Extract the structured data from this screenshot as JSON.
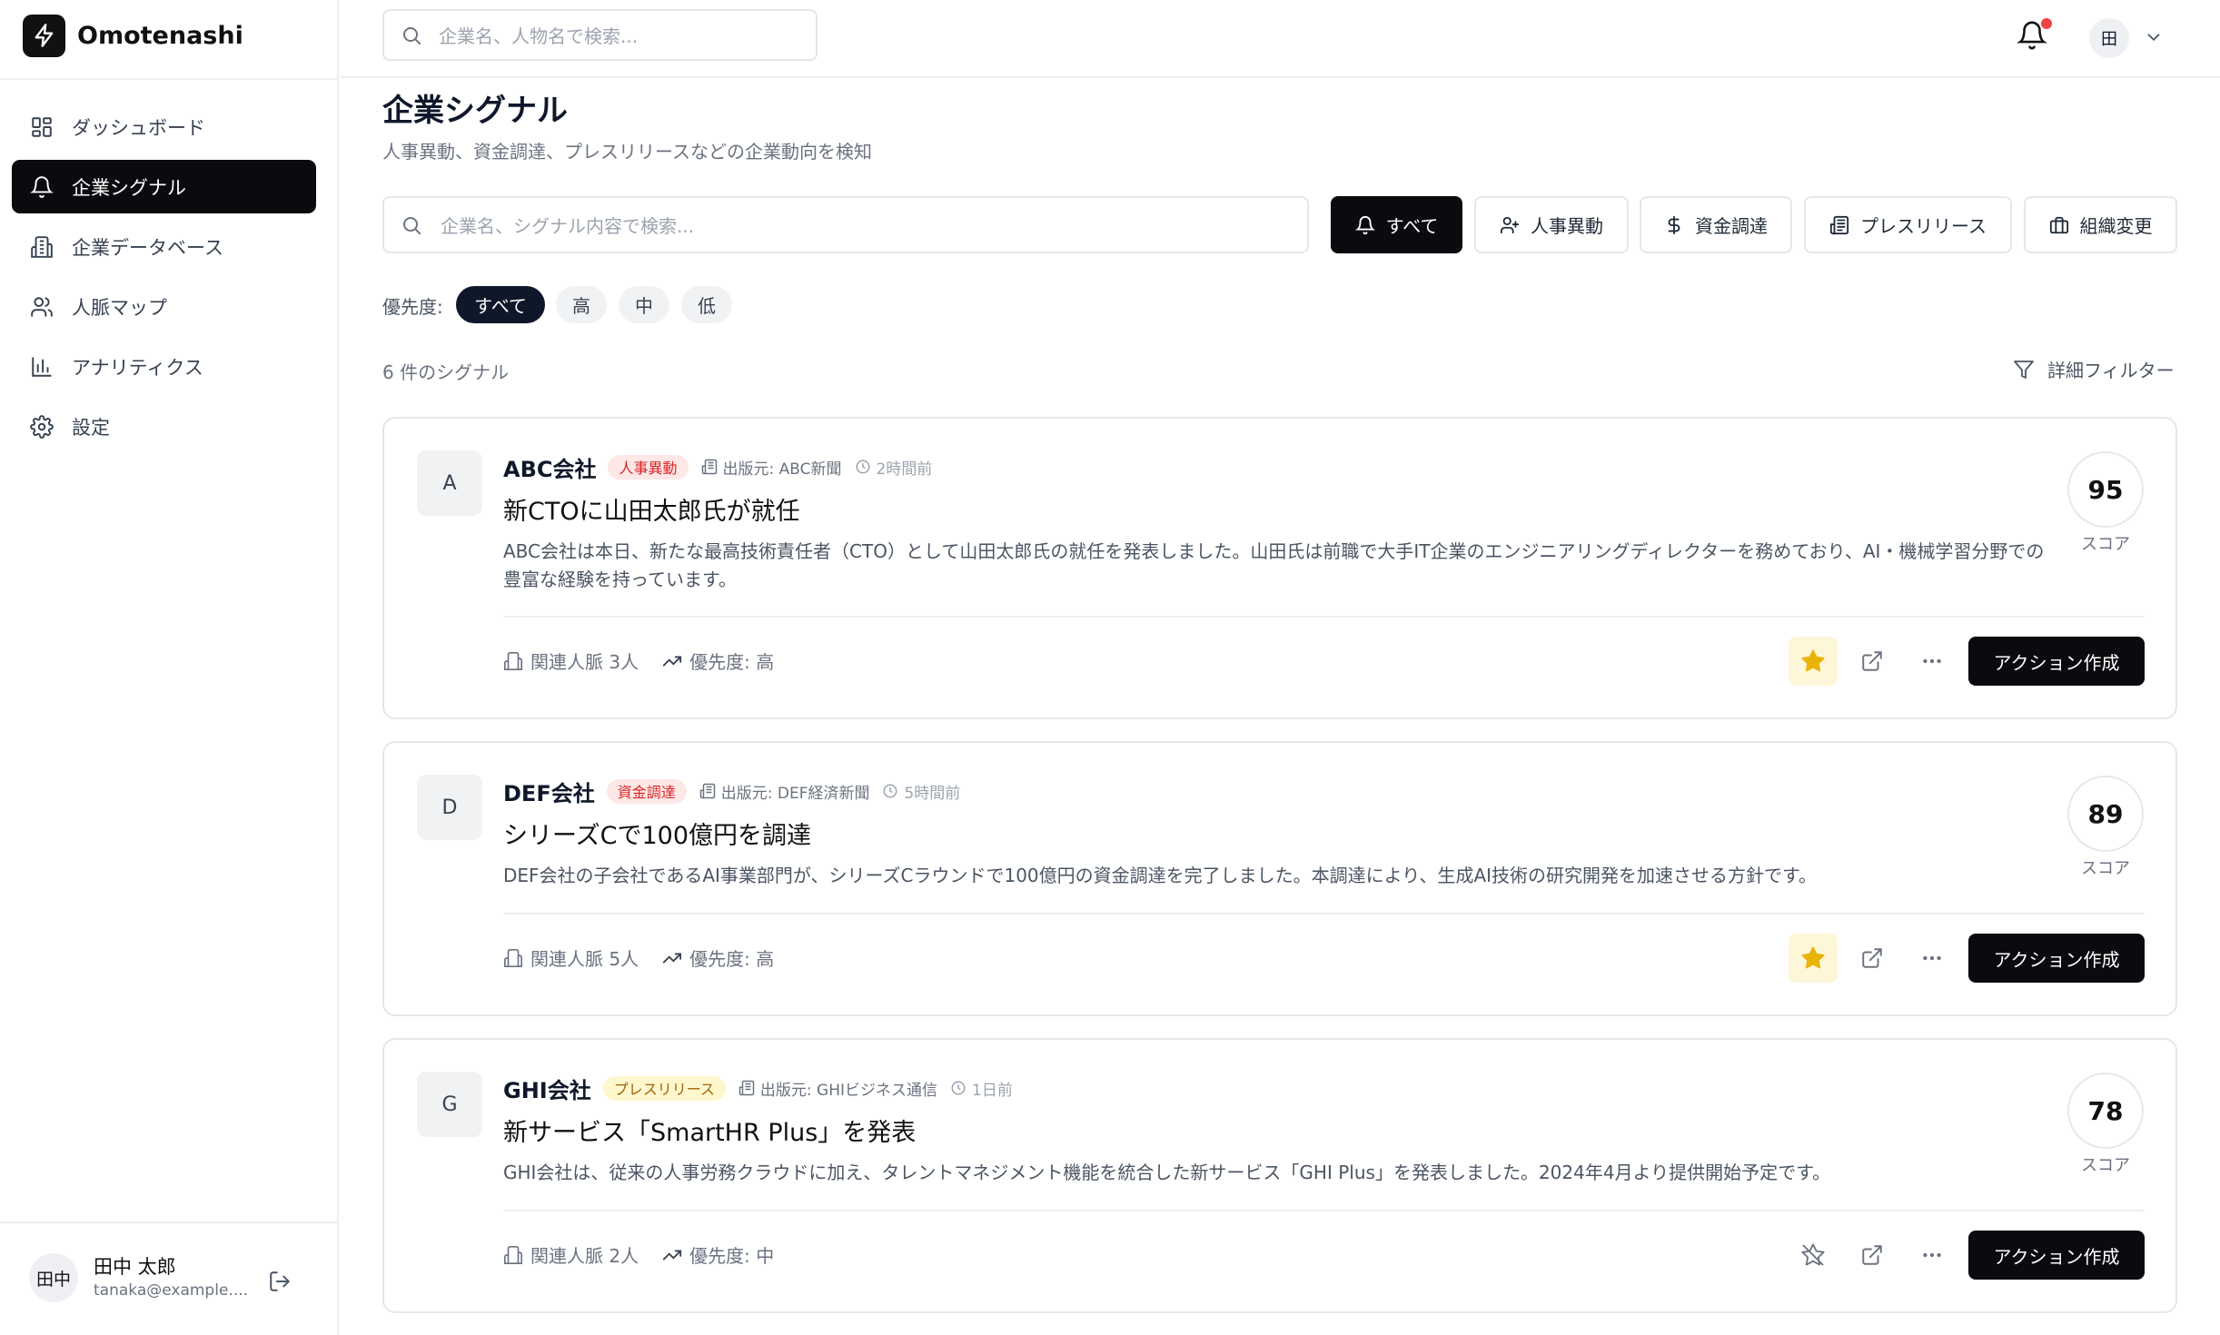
{
  "app": {
    "name": "Omotenashi"
  },
  "sidebar": {
    "items": [
      {
        "label": "ダッシュボード",
        "icon": "dashboard-icon"
      },
      {
        "label": "企業シグナル",
        "icon": "bell-icon",
        "active": true
      },
      {
        "label": "企業データベース",
        "icon": "building-icon"
      },
      {
        "label": "人脈マップ",
        "icon": "users-icon"
      },
      {
        "label": "アナリティクス",
        "icon": "bar-chart-icon"
      },
      {
        "label": "設定",
        "icon": "gear-icon"
      }
    ],
    "user": {
      "initials": "田中",
      "name": "田中 太郎",
      "email": "tanaka@example...."
    }
  },
  "topbar": {
    "search_placeholder": "企業名、人物名で検索...",
    "avatar_initial": "田"
  },
  "page": {
    "title": "企業シグナル",
    "subtitle": "人事異動、資金調達、プレスリリースなどの企業動向を検知"
  },
  "filters": {
    "search_placeholder": "企業名、シグナル内容で検索...",
    "types": [
      "すべて",
      "人事異動",
      "資金調達",
      "プレスリリース",
      "組織変更"
    ],
    "active_type": "すべて",
    "priority_label": "優先度:",
    "priorities": [
      "すべて",
      "高",
      "中",
      "低"
    ],
    "active_priority": "すべて",
    "count_text": "6 件のシグナル",
    "advanced_label": "詳細フィルター"
  },
  "signals": [
    {
      "initial": "A",
      "company": "ABC会社",
      "tag": "人事異動",
      "tag_color": "red",
      "source": "出版元: ABC新聞",
      "time": "2時間前",
      "title": "新CTOに山田太郎氏が就任",
      "description": "ABC会社は本日、新たな最高技術責任者（CTO）として山田太郎氏の就任を発表しました。山田氏は前職で大手IT企業のエンジニアリングディレクターを務めており、AI・機械学習分野での豊富な経験を持っています。",
      "related": "関連人脈 3人",
      "priority": "優先度: 高",
      "score": "95",
      "score_label": "スコア",
      "starred": true,
      "action_label": "アクション作成"
    },
    {
      "initial": "D",
      "company": "DEF会社",
      "tag": "資金調達",
      "tag_color": "red",
      "source": "出版元: DEF経済新聞",
      "time": "5時間前",
      "title": "シリーズCで100億円を調達",
      "description": "DEF会社の子会社であるAI事業部門が、シリーズCラウンドで100億円の資金調達を完了しました。本調達により、生成AI技術の研究開発を加速させる方針です。",
      "related": "関連人脈 5人",
      "priority": "優先度: 高",
      "score": "89",
      "score_label": "スコア",
      "starred": true,
      "action_label": "アクション作成"
    },
    {
      "initial": "G",
      "company": "GHI会社",
      "tag": "プレスリリース",
      "tag_color": "yellow",
      "source": "出版元: GHIビジネス通信",
      "time": "1日前",
      "title": "新サービス「SmartHR Plus」を発表",
      "description": "GHI会社は、従来の人事労務クラウドに加え、タレントマネジメント機能を統合した新サービス「GHI Plus」を発表しました。2024年4月より提供開始予定です。",
      "related": "関連人脈 2人",
      "priority": "優先度: 中",
      "score": "78",
      "score_label": "スコア",
      "starred": false,
      "action_label": "アクション作成"
    }
  ],
  "colors": {
    "primary": "#0b0b0f",
    "star": "#eab308",
    "notification": "#ef4444",
    "badge_red_bg": "#fde7e7",
    "badge_yellow_bg": "#fef7cd"
  }
}
